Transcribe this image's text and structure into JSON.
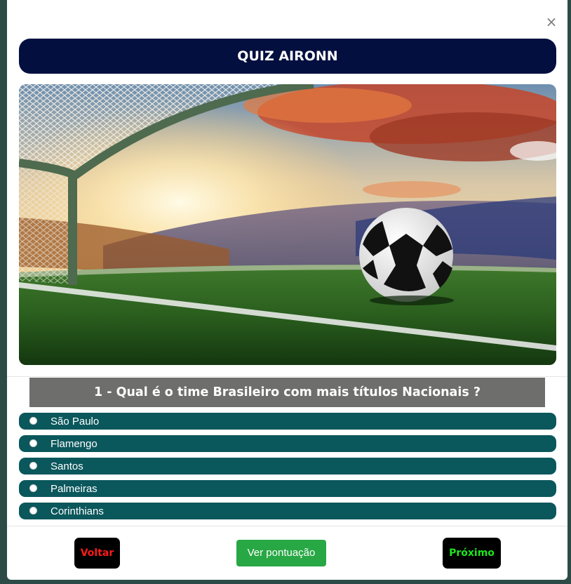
{
  "modal": {
    "close_label": "×",
    "title": "QUIZ AIRONN"
  },
  "hero": {
    "description_icon": "soccer-stadium-image"
  },
  "question": {
    "text": "1 - Qual é o time Brasileiro com mais títulos Nacionais ?"
  },
  "options": [
    {
      "label": "São Paulo",
      "selected": false
    },
    {
      "label": "Flamengo",
      "selected": false
    },
    {
      "label": "Santos",
      "selected": false
    },
    {
      "label": "Palmeiras",
      "selected": false
    },
    {
      "label": "Corinthians",
      "selected": false
    }
  ],
  "footer": {
    "back_label": "Voltar",
    "score_label": "Ver pontuação",
    "next_label": "Próximo"
  },
  "colors": {
    "title_bg": "#020f3f",
    "option_bg": "#0a575c",
    "question_bg": "#6e6e6c",
    "score_btn": "#28a745",
    "back_text": "#ff1a1a",
    "next_text": "#1ee61e"
  }
}
